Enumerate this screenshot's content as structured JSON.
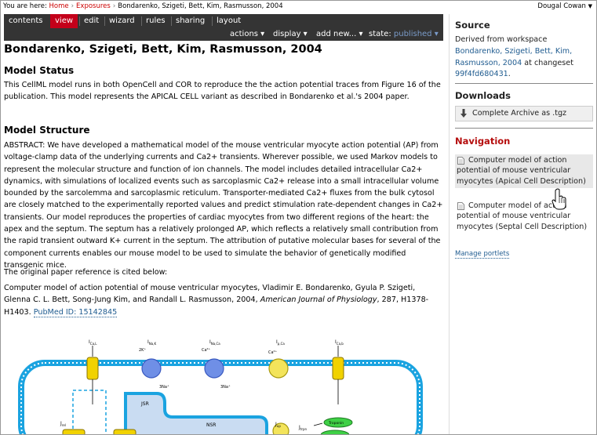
{
  "breadcrumb": {
    "prefix": "You are here:",
    "items": [
      "Home",
      "Exposures",
      "Bondarenko, Szigeti, Bett, Kim, Rasmusson, 2004"
    ],
    "separator": "›"
  },
  "user": {
    "name": "Dougal Cowan",
    "caret": "▼"
  },
  "tabs": [
    {
      "label": "contents"
    },
    {
      "label": "view",
      "active": true
    },
    {
      "label": "edit"
    },
    {
      "label": "wizard"
    },
    {
      "label": "rules"
    },
    {
      "label": "sharing"
    },
    {
      "label": "layout"
    }
  ],
  "actions": {
    "actions": "actions ▾",
    "display": "display ▾",
    "add_new": "add new... ▾",
    "state_label": "state:",
    "state_value": "published ▾"
  },
  "page": {
    "title": "Bondarenko, Szigeti, Bett, Kim, Rasmusson, 2004",
    "status_heading": "Model Status",
    "status_text": "This CellML model runs in both OpenCell and COR to reproduce the the action potential traces from Figure 16 of the publication. This model represents the APICAL CELL variant as described in Bondarenko et al.'s 2004 paper.",
    "structure_heading": "Model Structure",
    "abstract": "ABSTRACT: We have developed a mathematical model of the mouse ventricular myocyte action potential (AP) from voltage-clamp data of the underlying currents and Ca2+ transients. Wherever possible, we used Markov models to represent the molecular structure and function of ion channels. The model includes detailed intracellular Ca2+ dynamics, with simulations of localized events such as sarcoplasmic Ca2+ release into a small intracellular volume bounded by the sarcolemma and sarcoplasmic reticulum. Transporter-mediated Ca2+ fluxes from the bulk cytosol are closely matched to the experimentally reported values and predict stimulation rate-dependent changes in Ca2+ transients. Our model reproduces the properties of cardiac myocytes from two different regions of the heart: the apex and the septum. The septum has a relatively prolonged AP, which reflects a relatively small contribution from the rapid transient outward K+ current in the septum. The attribution of putative molecular bases for several of the component currents enables our mouse model to be used to simulate the behavior of genetically modified transgenic mice.",
    "ref_intro": "The original paper reference is cited below:",
    "ref_authors": "Computer model of action potential of mouse ventricular myocytes, Vladimir E. Bondarenko, Gyula P. Szigeti, Glenna C. L. Bett, Song-Jung Kim, and Randall L. Rasmusson, 2004,",
    "ref_journal": "American Journal of Physiology",
    "ref_tail": ", 287, H1378-H1403.",
    "pubmed": "PubMed ID: 15142845"
  },
  "figure_labels": {
    "ica_l": "I",
    "ica_l_sub": "Ca,L",
    "ina_k": "I",
    "ina_k_sub": "Na,K",
    "inaca": "I",
    "inaca_sub": "Na,Ca",
    "ipca": "I",
    "ipca_sub": "p,Ca",
    "icab": "I",
    "icab_sub": "Ca,b",
    "k2": "2K⁺",
    "ca2": "Ca²⁺",
    "ca2b": "Ca²⁺",
    "na3": "3Na⁺",
    "na3b": "3Na⁺",
    "jsr": "JSR",
    "nsr": "NSR",
    "jrel": "J",
    "jrel_sub": "rel",
    "jup": "J",
    "jup_sub": "up",
    "jtrpn": "J",
    "jtrpn_sub": "trpn",
    "troponin": "Troponin"
  },
  "sidebar": {
    "source_heading": "Source",
    "derived_prefix": "Derived from workspace",
    "workspace_link": "Bondarenko, Szigeti, Bett, Kim, Rasmusson, 2004",
    "at_changeset": "at changeset",
    "changeset": "99f4fd680431",
    "downloads_heading": "Downloads",
    "archive_label": "Complete Archive as .tgz",
    "navigation_heading": "Navigation",
    "nav_items": [
      "Computer model of action potential of mouse ventricular myocytes (Apical Cell Description)",
      "Computer model of action potential of mouse ventricular myocytes (Septal Cell Description)"
    ],
    "manage": "Manage portlets"
  },
  "colors": {
    "tab_bg": "#343434",
    "tab_active": "#c4001a",
    "link": "#205c90",
    "breadcrumb_link": "#cc0000",
    "nav_heading": "#b50d0d",
    "membrane": "#1aa3e0",
    "sr_fill": "#c9dcf2"
  }
}
